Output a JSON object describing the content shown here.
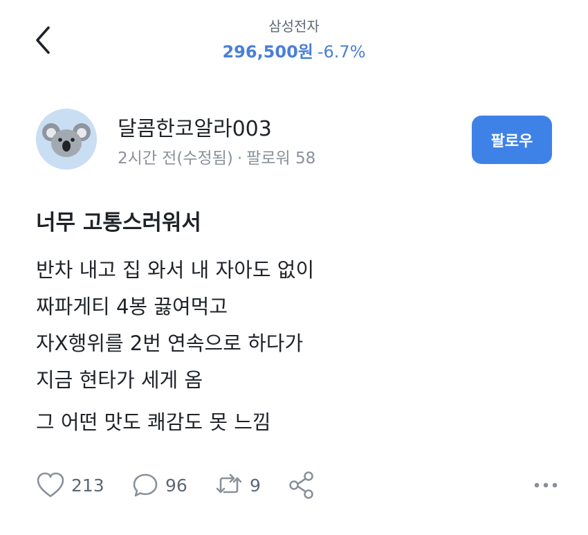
{
  "header": {
    "stock_name": "삼성전자",
    "price": "296,500원",
    "change": "-6.7%",
    "accent_color": "#4a7fd6"
  },
  "author": {
    "avatar_icon": "koala-avatar-icon",
    "name": "달콤한코알라003",
    "time": "2시간 전(수정됨)",
    "separator": "·",
    "followers_label": "팔로워 58",
    "follow_label": "팔로우",
    "follow_color": "#3f82e7"
  },
  "post": {
    "title": "너무 고통스러워서",
    "lines": [
      "반차 내고 집 와서 내 자아도 없이",
      "짜파게티 4봉 끓여먹고",
      "자X행위를 2번 연속으로 하다가",
      "지금 현타가 세게 옴"
    ],
    "closing": "그 어떤 맛도 쾌감도 못 느낌"
  },
  "actions": {
    "likes": "213",
    "comments": "96",
    "reposts": "9",
    "icons": [
      "heart-icon",
      "comment-icon",
      "repost-icon",
      "share-icon",
      "more-icon"
    ]
  }
}
